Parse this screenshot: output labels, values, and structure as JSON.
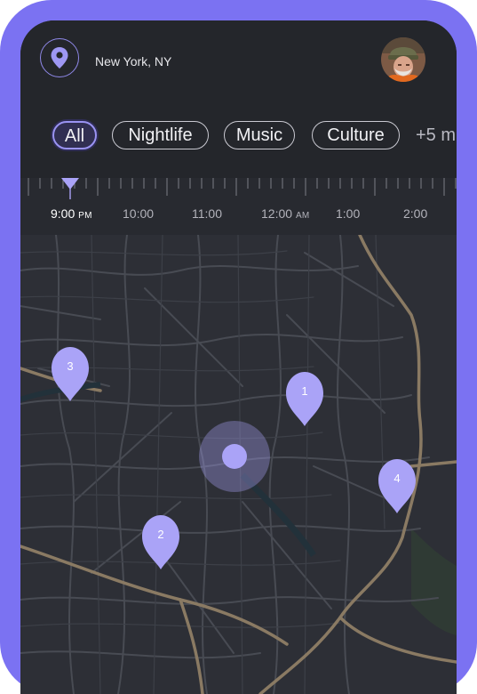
{
  "header": {
    "location_icon": "map-pin-icon",
    "location": "New York, NY",
    "avatar": "user-avatar"
  },
  "filters": {
    "chips": [
      {
        "label": "All",
        "active": true
      },
      {
        "label": "Nightlife",
        "active": false
      },
      {
        "label": "Music",
        "active": false
      },
      {
        "label": "Culture",
        "active": false
      }
    ],
    "more": "+5 m"
  },
  "timeline": {
    "labels": [
      {
        "time": "9:00",
        "suffix": "PM",
        "active": true
      },
      {
        "time": "10:00",
        "suffix": "",
        "active": false
      },
      {
        "time": "11:00",
        "suffix": "",
        "active": false
      },
      {
        "time": "12:00",
        "suffix": "AM",
        "active": false
      },
      {
        "time": "1:00",
        "suffix": "",
        "active": false
      },
      {
        "time": "2:00",
        "suffix": "",
        "active": false
      }
    ]
  },
  "map": {
    "pins": [
      {
        "label": "1"
      },
      {
        "label": "2"
      },
      {
        "label": "3"
      },
      {
        "label": "4"
      }
    ],
    "current_location": "current-location-marker"
  },
  "colors": {
    "accent": "#7b72f2",
    "pin": "#aaa3f7",
    "header_bg": "#24262b",
    "map_bg": "#2d2f36",
    "major_road": "#8a7a63",
    "minor_road": "#4a4d55"
  }
}
